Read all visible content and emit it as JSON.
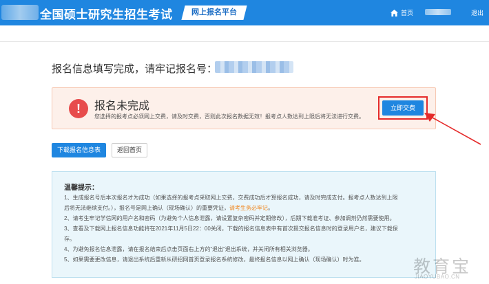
{
  "header": {
    "title": "全国硕士研究生招生考试",
    "platform_label": "网上报名平台",
    "home_label": "首页",
    "logout_label": "退出"
  },
  "main": {
    "complete_message": "报名信息填写完成，请牢记报名号：",
    "alert": {
      "title": "报名未完成",
      "description": "您选择的报考点必须网上交费，请及时交费，否则此次报名数据无效！报考点人数达到上限后将无法进行交费。",
      "pay_button": "立即交费"
    },
    "actions": {
      "download_label": "下载报名信息表",
      "back_label": "返回首页"
    },
    "tips": {
      "title": "温馨提示：",
      "items": [
        {
          "pre": "1、生成报名号后本次报名才为成功（如果选择的报考点采取网上交费，交费成功后才算报名成功，请及时完成支付。报考点人数达到上限",
          "em": "",
          "post": ""
        },
        {
          "pre": "后将无法继续支付。），报名号是网上确认（现场确认）的重要凭证，",
          "em": "请考生务必牢记",
          "post": "。"
        },
        {
          "pre": "2、请考生牢记学信网的用户名和密码（为避免个人信息泄露，请设置复杂密码并定期修改），后期下载准考证、参加调剂仍然需要使用。",
          "em": "",
          "post": ""
        },
        {
          "pre": "3、查看及下载网上报名信息功能将在2021年11月5日22：00关闭，下载的报名信息表中有首次提交报名信息时的登录用户名，建议下载保",
          "em": "",
          "post": ""
        },
        {
          "pre": "存。",
          "em": "",
          "post": ""
        },
        {
          "pre": "4、为避免报名信息泄露，请在报名结束后点击页面右上方的“退出”退出系统，并关闭所有相关浏览器。",
          "em": "",
          "post": ""
        },
        {
          "pre": "5、如果需要更改信息，请退出系统后重新从研招网首页登录报名系统修改，最终报名信息以网上确认（现场确认）时为准。",
          "em": "",
          "post": ""
        }
      ]
    }
  },
  "watermark": {
    "main": "教育宝",
    "sub": "JIAOYUBAO.CN"
  },
  "colors": {
    "header_bg": "#1f86e0",
    "primary": "#1f86e0",
    "alert_bg": "#fdf0ea",
    "alert_icon": "#e74c4c",
    "highlight_red": "#e52b2b",
    "tips_bg": "#eaf6fb",
    "emphasis_orange": "#f08a24"
  }
}
